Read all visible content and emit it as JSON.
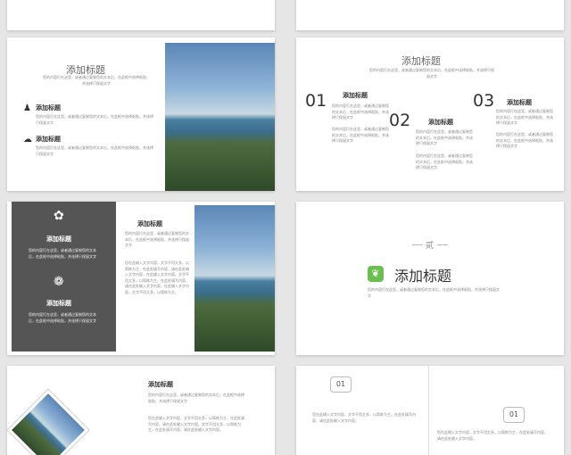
{
  "s1": {},
  "s2": {},
  "s3": {
    "title": "添加标题",
    "desc": "您的内容打在这里，或者通过复制您的文本后，在此框中选择粘贴，并选择只保留文字",
    "items": [
      {
        "icon": "person-trash-icon",
        "heading": "添加标题",
        "text": "您的内容打在这里，或者通过复制您的文本后，在此框中选择粘贴，并选择只保留文字"
      },
      {
        "icon": "cloud-icon",
        "heading": "添加标题",
        "text": "您的内容打在这里，或者通过复制您的文本后，在此框中选择粘贴，并选择只保留文字"
      }
    ]
  },
  "s4": {
    "title": "添加标题",
    "desc": "您的内容打在这里，或者通过复制您的文本后，在此框中选择粘贴，并选择只保留文字",
    "cols": [
      {
        "num": "01",
        "heading": "添加标题",
        "text1": "您的内容打在这里，或者通过复制您的文本后，在此框中选择粘贴，并选择只保留文字",
        "text2": "您的内容打在这里，或者通过复制您的文本后，在此框中选择粘贴，并选择只保留文字"
      },
      {
        "num": "02",
        "heading": "添加标题",
        "text1": "您的内容打在这里，或者通过复制您的文本后，在此框中选择粘贴，并选择只保留文字",
        "text2": "您的内容打在这里，或者通过复制您的文本后，在此框中选择粘贴，并选择只保留文字"
      },
      {
        "num": "03",
        "heading": "添加标题",
        "text1": "您的内容打在这里，或者通过复制您的文本后，在此框中选择粘贴，并选择只保留文字",
        "text2": "您的内容打在这里，或者通过复制您的文本后，在此框中选择粘贴，并选择只保留文字"
      }
    ]
  },
  "s5": {
    "left1": {
      "heading": "添加标题",
      "text": "您的内容打在这里，或者通过复制您的文本后，在此框中选择粘贴，并选择只保留文字"
    },
    "left2": {
      "heading": "添加标题",
      "text": "您的内容打在这里，或者通过复制您的文本后，在此框中选择粘贴，并选择只保留文字"
    },
    "mid": {
      "heading": "添加标题",
      "desc": "您的内容打在这里，或者通过复制您的文本后，在此框中选择粘贴，并选择只保留文字",
      "body": "您在此输入文字内容，文字不用太多，以简练为主，在此处填写内容，请在此处输入文字内容，在此输入文字内容。文字不用太多，以简练为主，在此处填写内容，请在此处输入文字内容，在此输入文字内容，文字不用太多，以简练为主。"
    }
  },
  "s6": {
    "chapter": "贰",
    "title": "添加标题",
    "desc": "您的内容打在这里，或者通过复制您的文本后，在此框中选择粘贴，并选择只保留文字"
  },
  "s7": {
    "heading": "添加标题",
    "desc": "您的内容打在这里，或者通过复制您的文本后，在此框中选择粘贴，并选择只保留文字",
    "body": "您在此输入文字内容，文字不用太多，以简练为主，在此处填写内容，请在此处输入文字内容。文字不用太多，以简练为主，在此处填写内容，请在此处输入文字内容。"
  },
  "s8": {
    "badges": [
      "01",
      "01"
    ],
    "text1": "您在此输入文字内容，文字不用太多，以简练为主，在此处填写内容，请在此处输入文字内容。",
    "text2": "您在此输入文字内容，文字不用太多，以简练为主，在此处填写内容，请在此处输入文字内容。"
  }
}
